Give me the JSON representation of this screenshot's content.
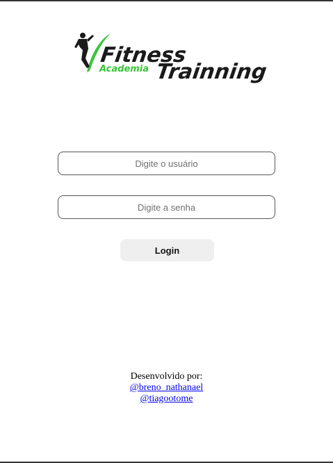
{
  "logo": {
    "word1": "Fitness",
    "word2": "Academia",
    "word3": "Trainning",
    "accent_color": "#3cc43c"
  },
  "form": {
    "user_placeholder": "Digite o usuário",
    "password_placeholder": "Digite a senha",
    "login_label": "Login"
  },
  "footer": {
    "developed_by": "Desenvolvido por:",
    "authors": [
      "@breno_nathanael",
      "@tiagootome"
    ]
  }
}
